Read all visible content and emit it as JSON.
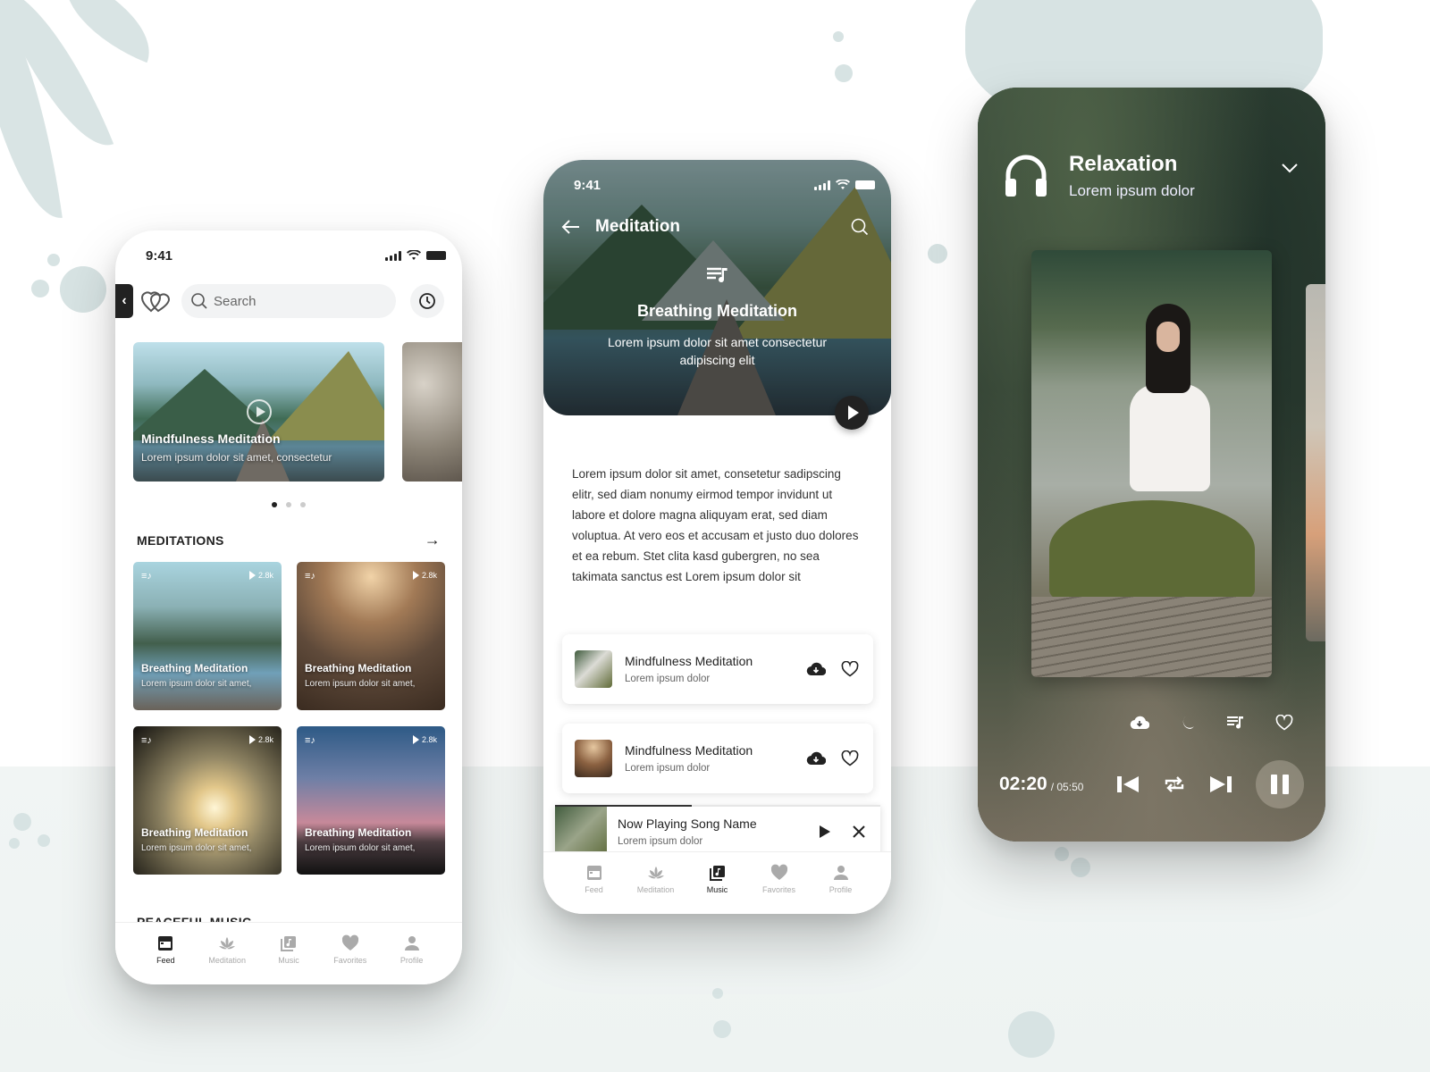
{
  "colors": {
    "accent_dark": "#222222",
    "background_mint": "#d7e3e3",
    "player_bg": "#2c3a30"
  },
  "feed_screen": {
    "status_time": "9:41",
    "side_tab_icon": "chevron-left-icon",
    "logo_icon": "double-heart-icon",
    "search": {
      "placeholder": "Search",
      "value": ""
    },
    "history_icon": "clock-icon",
    "hero_cards": [
      {
        "title": "Mindfulness Meditation",
        "subtitle": "Lorem ipsum dolor sit amet, consectetur"
      }
    ],
    "carousel": {
      "count": 3,
      "active_index": 0
    },
    "meditations": {
      "heading": "MEDITATIONS",
      "items": [
        {
          "title": "Breathing Meditation",
          "subtitle": "Lorem ipsum dolor sit amet,",
          "plays": "2.8k"
        },
        {
          "title": "Breathing Meditation",
          "subtitle": "Lorem ipsum dolor sit amet,",
          "plays": "2.8k"
        },
        {
          "title": "Breathing Meditation",
          "subtitle": "Lorem ipsum dolor sit amet,",
          "plays": "2.8k"
        },
        {
          "title": "Breathing Meditation",
          "subtitle": "Lorem ipsum dolor sit amet,",
          "plays": "2.8k"
        }
      ]
    },
    "peaceful_music": {
      "heading": "PEACEFUL MUSIC"
    },
    "nav": {
      "active": "Feed",
      "items": [
        "Feed",
        "Meditation",
        "Music",
        "Favorites",
        "Profile"
      ]
    }
  },
  "detail_screen": {
    "status_time": "9:41",
    "title": "Meditation",
    "hero_title": "Breathing Meditation",
    "hero_subtitle": "Lorem ipsum dolor sit amet consectetur adipiscing elit",
    "description": "Lorem ipsum dolor sit amet, consetetur sadipscing elitr, sed diam nonumy eirmod tempor invidunt ut labore et dolore magna aliquyam erat, sed diam voluptua. At vero eos et accusam et justo duo dolores et ea rebum. Stet clita kasd gubergren, no sea takimata sanctus est Lorem ipsum dolor sit",
    "tracks": [
      {
        "title": "Mindfulness Meditation",
        "subtitle": "Lorem ipsum dolor"
      },
      {
        "title": "Mindfulness Meditation",
        "subtitle": "Lorem ipsum dolor"
      }
    ],
    "now_playing": {
      "title": "Now Playing Song Name",
      "subtitle": "Lorem ipsum dolor",
      "progress_percent": 42
    },
    "nav": {
      "active": "Music",
      "items": [
        "Feed",
        "Meditation",
        "Music",
        "Favorites",
        "Profile"
      ]
    }
  },
  "player_screen": {
    "title": "Relaxation",
    "subtitle": "Lorem ipsum dolor",
    "current_time": "02:20",
    "total_time": "/ 05:50",
    "repeat_mode": "repeat-one",
    "state": "playing"
  }
}
